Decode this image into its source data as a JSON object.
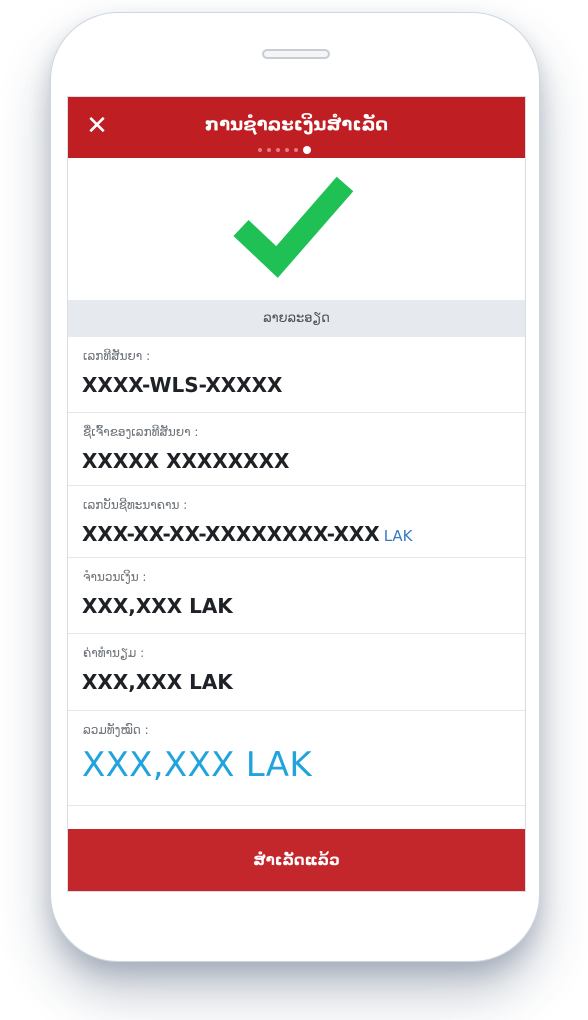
{
  "header": {
    "title": "ການຊຳລະເງິນສຳເລັດ",
    "close_icon": "close-icon",
    "step_count": 6,
    "current_step": 6
  },
  "success_icon": "checkmark-icon",
  "colors": {
    "header_bg": "#bf1e23",
    "checkmark": "#1fc155",
    "total_value": "#21a3dd",
    "currency_accent": "#3a78c6",
    "button_bg": "#c3272b"
  },
  "section": {
    "title": "ລາຍລະອຽດ"
  },
  "details": [
    {
      "label": "ເລກທີສັນຍາ :",
      "value": "XXXX-WLS-XXXXX"
    },
    {
      "label": "ຊື່ເຈົ້າຂອງເລກທີສັນຍາ :",
      "value": "XXXXX  XXXXXXXX"
    },
    {
      "label": "ເລກບັນຊີທະນາຄານ :",
      "value": "XXX-XX-XX-XXXXXXXX-XXX",
      "currency": "LAK"
    },
    {
      "label": "ຈຳນວນເງິນ :",
      "value": "XXX,XXX LAK"
    },
    {
      "label": "ຄ່າທຳນຽມ :",
      "value": "XXX,XXX LAK"
    }
  ],
  "total": {
    "label": "ລວມທັງໝົດ :",
    "value": "XXX,XXX",
    "currency": "LAK"
  },
  "footer": {
    "button_label": "ສຳເລັດແລ້ວ"
  }
}
